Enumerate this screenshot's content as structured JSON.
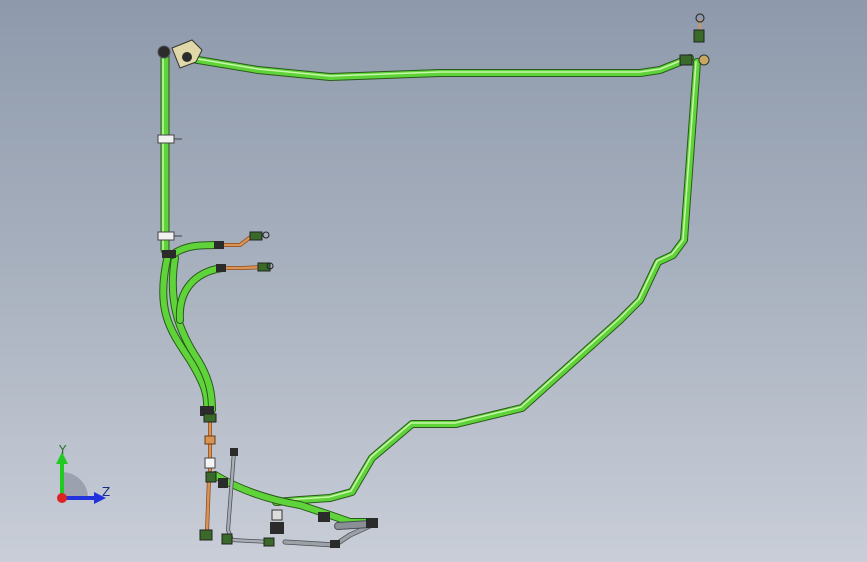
{
  "viewport": {
    "background_top": "#8e9aac",
    "background_bottom": "#c9ced8",
    "tube_color": "#5fd33a",
    "tube_highlight": "#b8f59a",
    "tube_shadow": "#2e7a1a",
    "copper_color": "#c8844a",
    "grey_color": "#8a8f96"
  },
  "triad": {
    "y_label": "Y",
    "z_label": "Z",
    "y_color": "#22c922",
    "z_color": "#2233dd",
    "x_color": "#dd2222"
  }
}
